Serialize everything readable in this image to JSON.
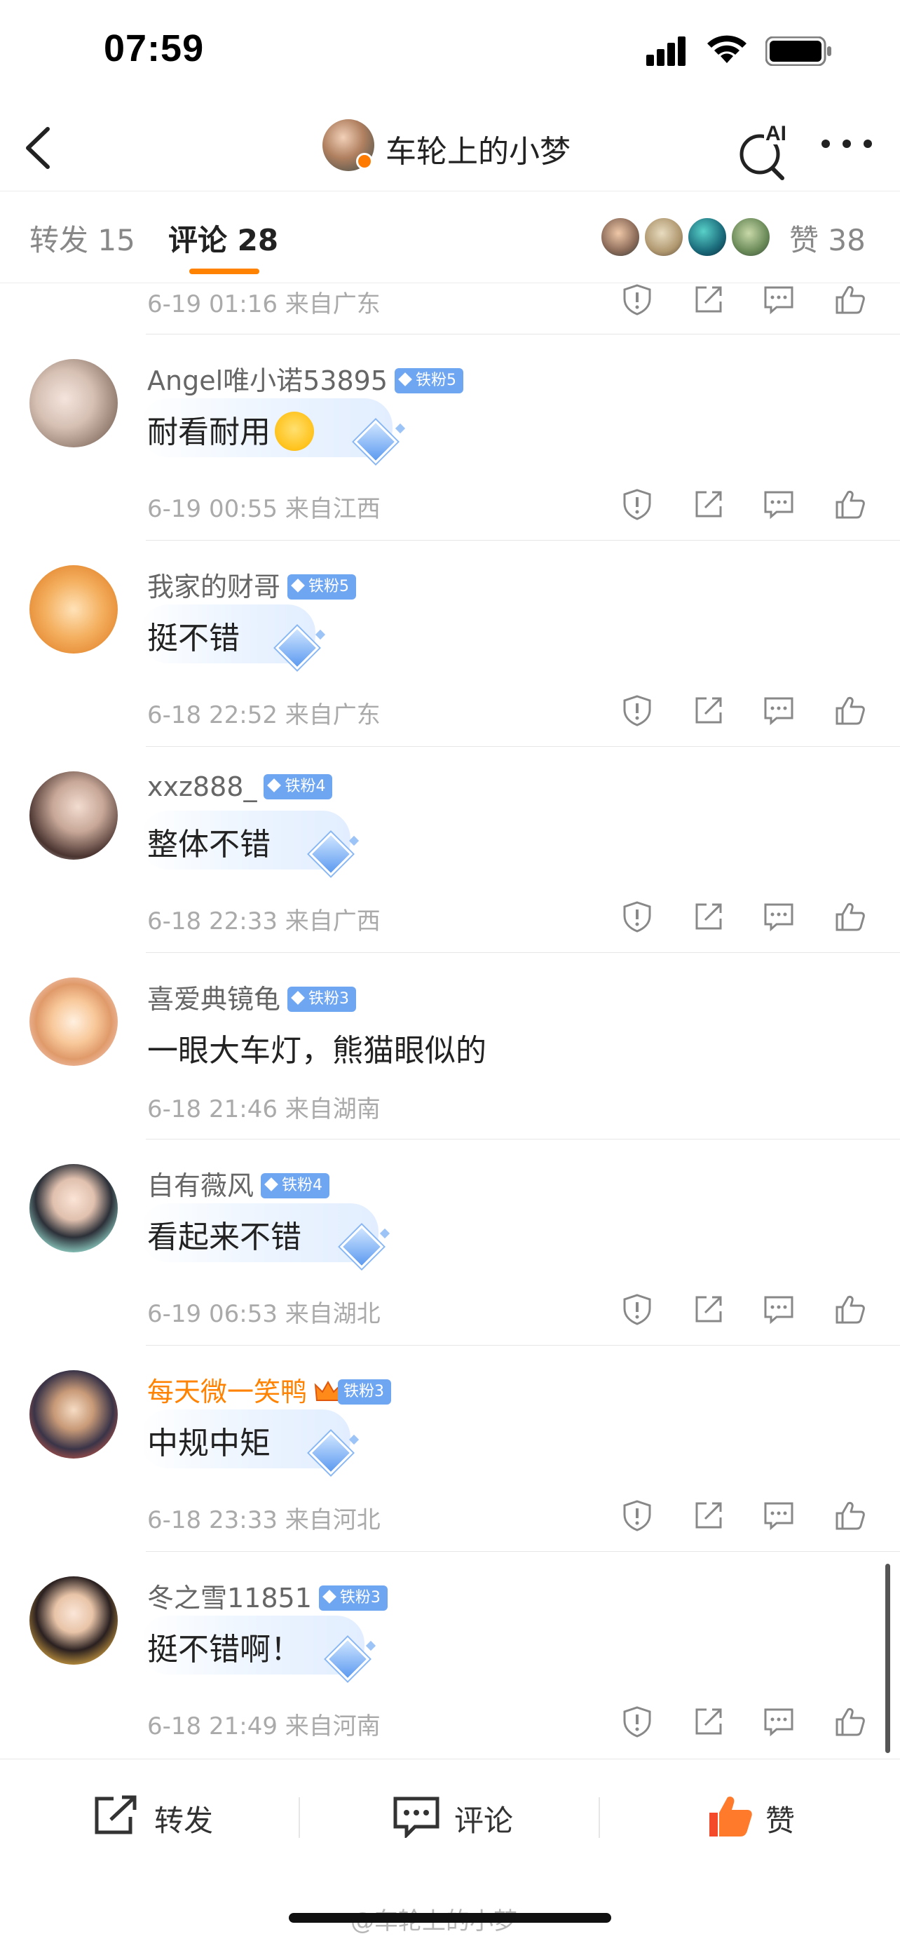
{
  "status_bar": {
    "time": "07:59"
  },
  "nav": {
    "title": "车轮上的小梦",
    "ai_label": "AI"
  },
  "tabs": {
    "repost": "转发 15",
    "comment": "评论 28",
    "likes": "赞 38"
  },
  "partial_comment": {
    "meta": "6-19 01:16  来自广东"
  },
  "comments": [
    {
      "user": "Angel唯小诺53895",
      "badge": "铁粉5",
      "text": "耐看耐用",
      "emoji": "smile-emoji",
      "meta": "6-19 00:55  来自江西"
    },
    {
      "user": "我家的财哥",
      "badge": "铁粉5",
      "text": "挺不错",
      "meta": "6-18 22:52  来自广东"
    },
    {
      "user": "xxz888_",
      "badge": "铁粉4",
      "text": "整体不错",
      "meta": "6-18 22:33  来自广西"
    },
    {
      "user": "喜爱典镜龟",
      "badge": "铁粉3",
      "text": "一眼大车灯，熊猫眼似的",
      "meta": "6-18 21:46  来自湖南"
    },
    {
      "user": "自有薇风",
      "badge": "铁粉4",
      "text": "看起来不错",
      "meta": "6-19 06:53  来自湖北"
    },
    {
      "user": "每天微一笑鸭",
      "badge": "铁粉3",
      "text": "中规中矩",
      "meta": "6-18 23:33  来自河北"
    },
    {
      "user": "冬之雪11851",
      "badge": "铁粉3",
      "text": "挺不错啊！",
      "meta": "6-18 21:49  来自河南"
    }
  ],
  "bottom_bar": {
    "repost": "转发",
    "comment": "评论",
    "like": "赞"
  },
  "watermark": "@车轮上的小梦",
  "colors": {
    "accent": "#ff8200",
    "badge_blue": "#6fa6f2",
    "username_vip": "#ff8200"
  },
  "icons": [
    "back-icon",
    "ai-search-icon",
    "more-icon",
    "report-icon",
    "share-icon",
    "comment-icon",
    "like-icon"
  ]
}
